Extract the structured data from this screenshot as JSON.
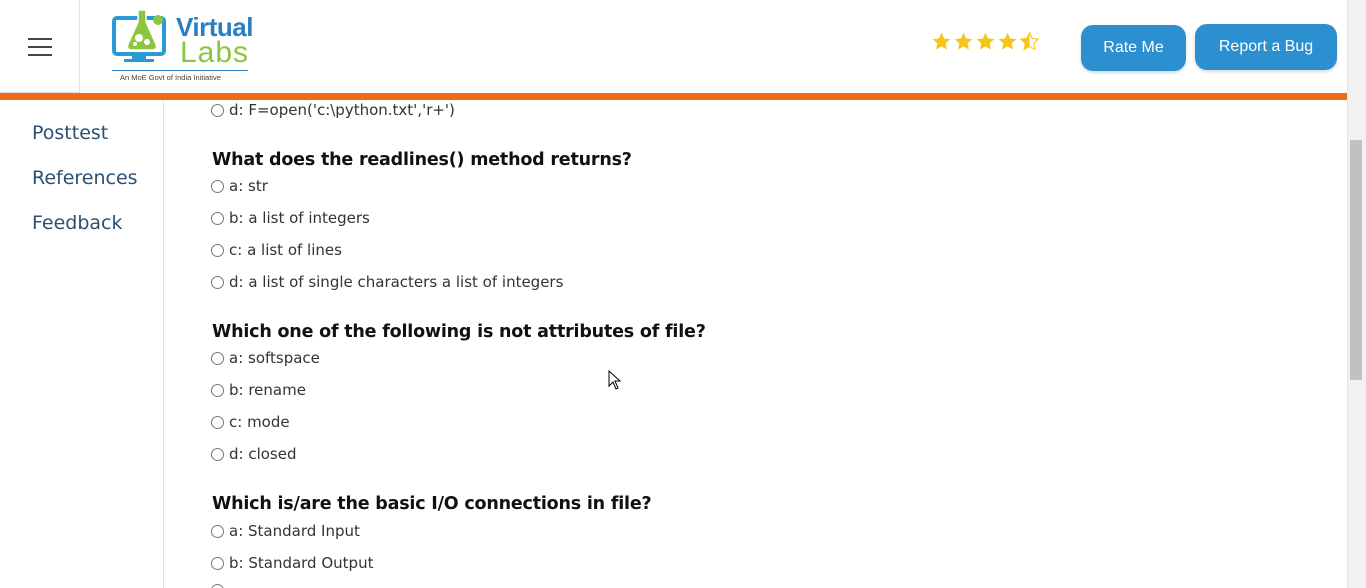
{
  "header": {
    "logo_word1": "Virtual",
    "logo_word2": "Labs",
    "logo_tagline": "An MoE Govt of India Initiative",
    "rating": 4.5,
    "rate_me_label": "Rate Me",
    "report_bug_label": "Report a Bug"
  },
  "sidebar": {
    "items": [
      {
        "label": "Posttest"
      },
      {
        "label": "References"
      },
      {
        "label": "Feedback"
      }
    ]
  },
  "content": {
    "prev_option": "d: F=open('c:\\python.txt','r+')",
    "questions": [
      {
        "title": "What does the readlines() method returns?",
        "options": [
          "a: str",
          "b: a list of integers",
          "c: a list of lines",
          "d: a list of single characters a list of integers"
        ]
      },
      {
        "title": "Which one of the following is not attributes of file?",
        "options": [
          "a: softspace",
          "b: rename",
          "c: mode",
          "d: closed"
        ]
      },
      {
        "title": "Which is/are the basic I/O connections in file?",
        "options": [
          "a: Standard Input",
          "b: Standard Output"
        ]
      }
    ]
  },
  "colors": {
    "accent_orange": "#ef6c12",
    "button_blue": "#2b8fd0",
    "star_gold": "#f5c518",
    "sidebar_link": "#2c4f72"
  },
  "icons": {
    "menu": "hamburger-icon",
    "star": "star-icon",
    "cursor": "mouse-pointer-icon"
  }
}
